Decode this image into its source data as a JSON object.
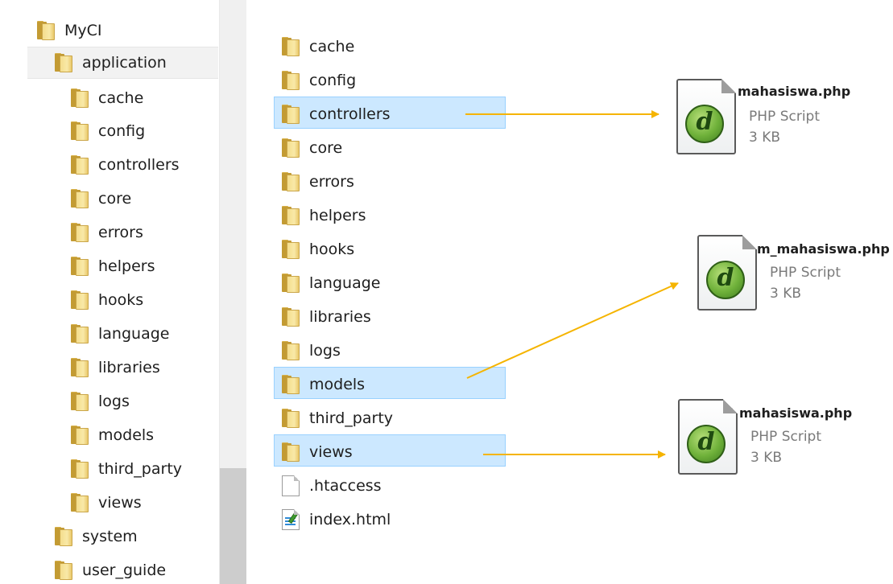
{
  "tree": {
    "root": "MyCI",
    "application": "application",
    "children": [
      "cache",
      "config",
      "controllers",
      "core",
      "errors",
      "helpers",
      "hooks",
      "language",
      "libraries",
      "logs",
      "models",
      "third_party",
      "views"
    ],
    "system": "system",
    "user_guide": "user_guide"
  },
  "folder_contents": {
    "folders": [
      "cache",
      "config",
      "controllers",
      "core",
      "errors",
      "helpers",
      "hooks",
      "language",
      "libraries",
      "logs",
      "models",
      "third_party",
      "views"
    ],
    "files": [
      ".htaccess",
      "index.html"
    ],
    "highlighted": [
      "controllers",
      "models",
      "views"
    ]
  },
  "php_files": [
    {
      "name": "mahasiswa.php",
      "type": "PHP Script",
      "size": "3 KB",
      "linked_from": "controllers"
    },
    {
      "name": "m_mahasiswa.php",
      "type": "PHP Script",
      "size": "3 KB",
      "linked_from": "models"
    },
    {
      "name": "mahasiswa.php",
      "type": "PHP Script",
      "size": "3 KB",
      "linked_from": "views"
    }
  ],
  "colors": {
    "arrow": "#f5b400",
    "highlight_fill": "#cce8ff",
    "highlight_border": "#99d1ff",
    "tree_selected": "#f2f2f2"
  }
}
